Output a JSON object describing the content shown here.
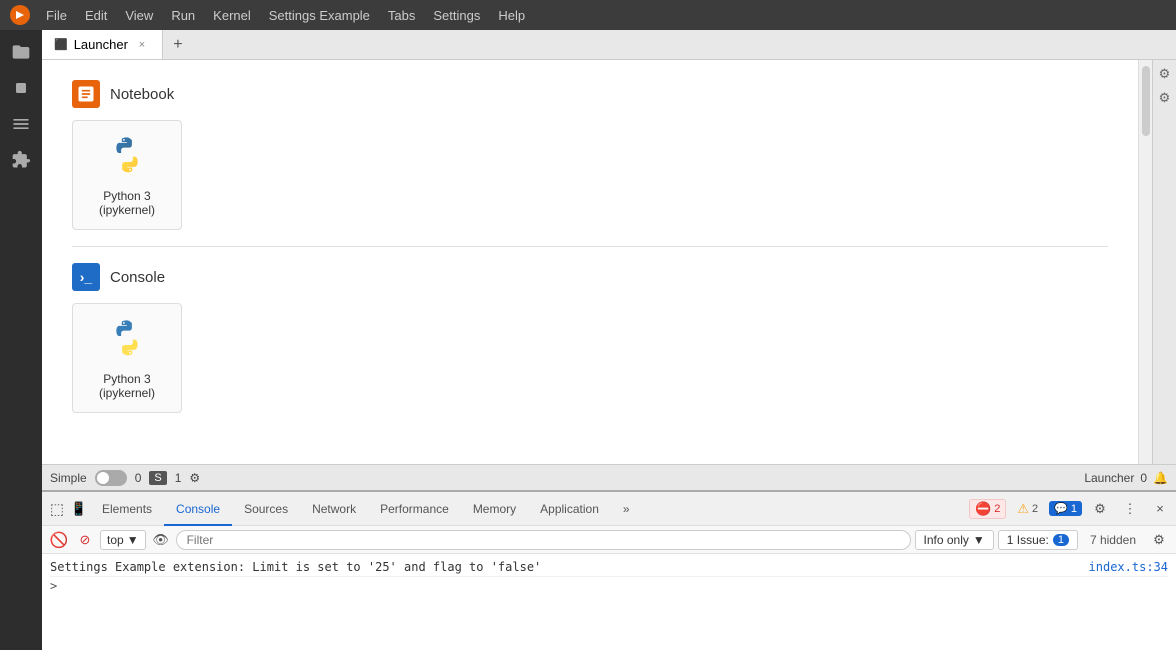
{
  "menubar": {
    "items": [
      "File",
      "Edit",
      "View",
      "Run",
      "Kernel",
      "Settings Example",
      "Tabs",
      "Settings",
      "Help"
    ]
  },
  "sidebar": {
    "icons": [
      "folder-icon",
      "stop-icon",
      "list-icon",
      "puzzle-icon"
    ]
  },
  "tabs": {
    "active": "Launcher",
    "items": [
      {
        "label": "Launcher",
        "icon": "⬛"
      }
    ]
  },
  "launcher": {
    "sections": [
      {
        "title": "Notebook",
        "cards": [
          {
            "label": "Python 3\n(ipykernel)",
            "type": "python"
          }
        ]
      },
      {
        "title": "Console",
        "cards": [
          {
            "label": "Python 3\n(ipykernel)",
            "type": "python"
          }
        ]
      }
    ]
  },
  "statusbar": {
    "left": {
      "mode": "Simple",
      "toggle": false,
      "count1": "0",
      "kernel_badge": "S",
      "count2": "1",
      "settings_icon": "⚙"
    },
    "right": {
      "tab_label": "Launcher",
      "count": "0",
      "bell_icon": "🔔"
    }
  },
  "devtools": {
    "tabs": [
      "Elements",
      "Console",
      "Sources",
      "Network",
      "Performance",
      "Memory",
      "Application",
      "»"
    ],
    "active_tab": "Console",
    "badge_error": "2",
    "badge_warn": "2",
    "badge_info": "1",
    "toolbar": {
      "top_label": "top",
      "filter_placeholder": "Filter",
      "info_only": "Info only",
      "issue_label": "1 Issue:",
      "issue_count": "1",
      "hidden_label": "7 hidden"
    },
    "console_lines": [
      {
        "text": "Settings Example extension: Limit is set to '25' and flag to 'false'",
        "link": "index.ts:34"
      }
    ],
    "prompt": ">"
  }
}
